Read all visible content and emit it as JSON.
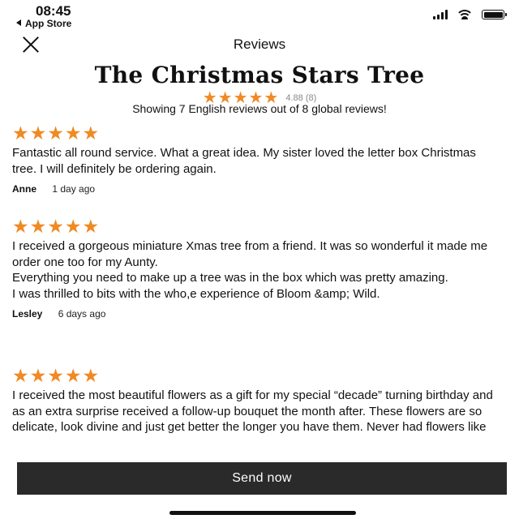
{
  "status_bar": {
    "time": "08:45",
    "back_app": "App Store"
  },
  "header": {
    "title": "Reviews"
  },
  "product": {
    "name": "The Christmas Stars Tree",
    "stars": "★★★★★",
    "rating": "4.88 (8)",
    "showing": "Showing 7 English reviews out of 8 global reviews!"
  },
  "reviews": [
    {
      "stars": "★★★★★",
      "text": "Fantastic all round service. What a great idea. My sister loved the letter box Christmas tree. I will definitely be ordering again.",
      "author": "Anne",
      "ago": "1 day ago"
    },
    {
      "stars": "★★★★★",
      "text": "I received a gorgeous miniature Xmas tree from a friend. It was so wonderful it made me order one too for my Aunty.\nEverything you need to make up a tree was in the box which was pretty amazing.\nI was thrilled to bits with the who,e experience of Bloom &amp; Wild.",
      "author": "Lesley",
      "ago": "6 days ago"
    },
    {
      "stars": "★★★★★",
      "text": "I received the most beautiful flowers as a gift for my special “decade” turning birthday and as an extra surprise received a follow-up bouquet the month after. These flowers are so delicate, look divine and just get better the longer you have them. Never had flowers like"
    }
  ],
  "cta": {
    "label": "Send now"
  },
  "colors": {
    "star": "#ef8a24",
    "button": "#2a2a2a"
  }
}
